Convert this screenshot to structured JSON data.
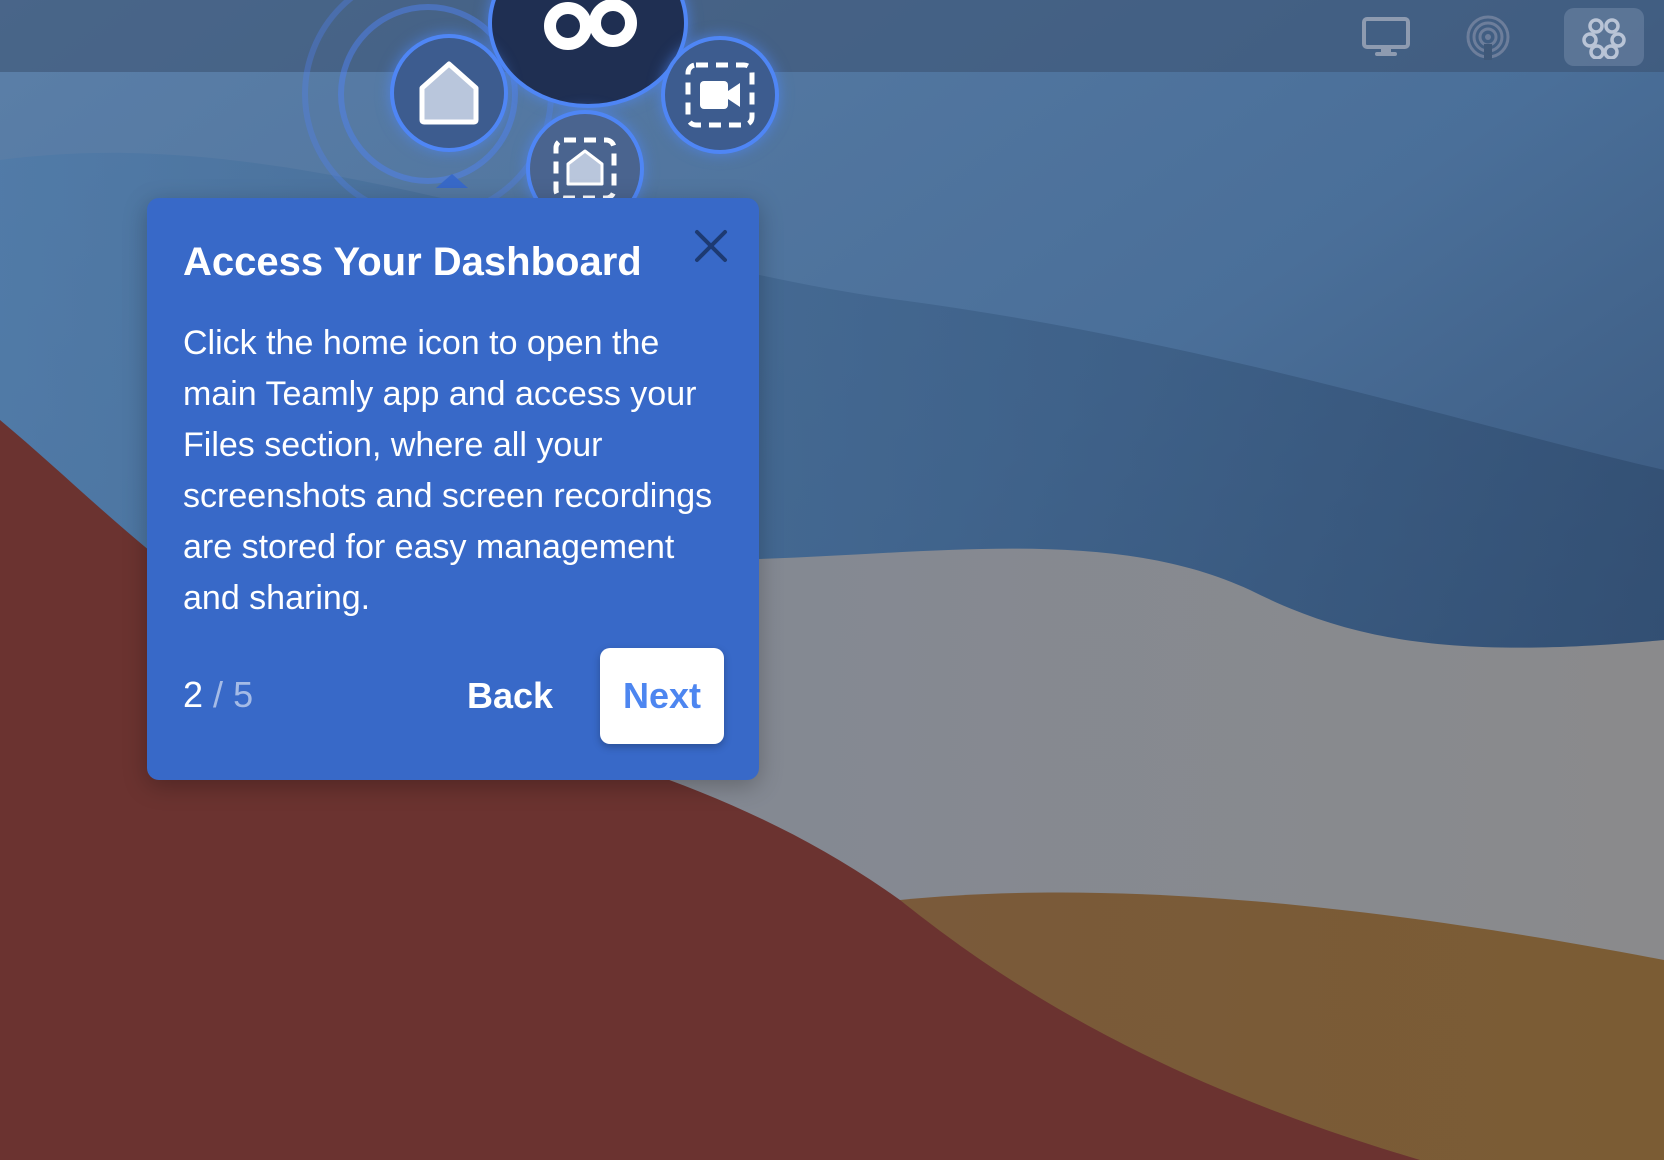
{
  "tour": {
    "title": "Access Your Dashboard",
    "body": "Click the home icon to open the main Teamly app and access your Files section, where all your screenshots and screen recordings are stored for easy management and sharing.",
    "step_current": "2",
    "step_separator": "/",
    "step_total": "5",
    "back_label": "Back",
    "next_label": "Next",
    "close_icon": "close-icon"
  },
  "launcher": {
    "items": [
      {
        "icon": "teamly-logo-icon"
      },
      {
        "icon": "home-icon"
      },
      {
        "icon": "screenshot-icon"
      },
      {
        "icon": "screen-record-icon"
      }
    ]
  },
  "menubar": {
    "icons": [
      "monitor-icon",
      "airdrop-icon",
      "teamly-logo-icon"
    ],
    "active_icon": "teamly-logo-icon"
  },
  "colors": {
    "card_background": "#3869c8",
    "next_button_text": "#4d86f0",
    "launcher_accent": "#4f86f5"
  }
}
